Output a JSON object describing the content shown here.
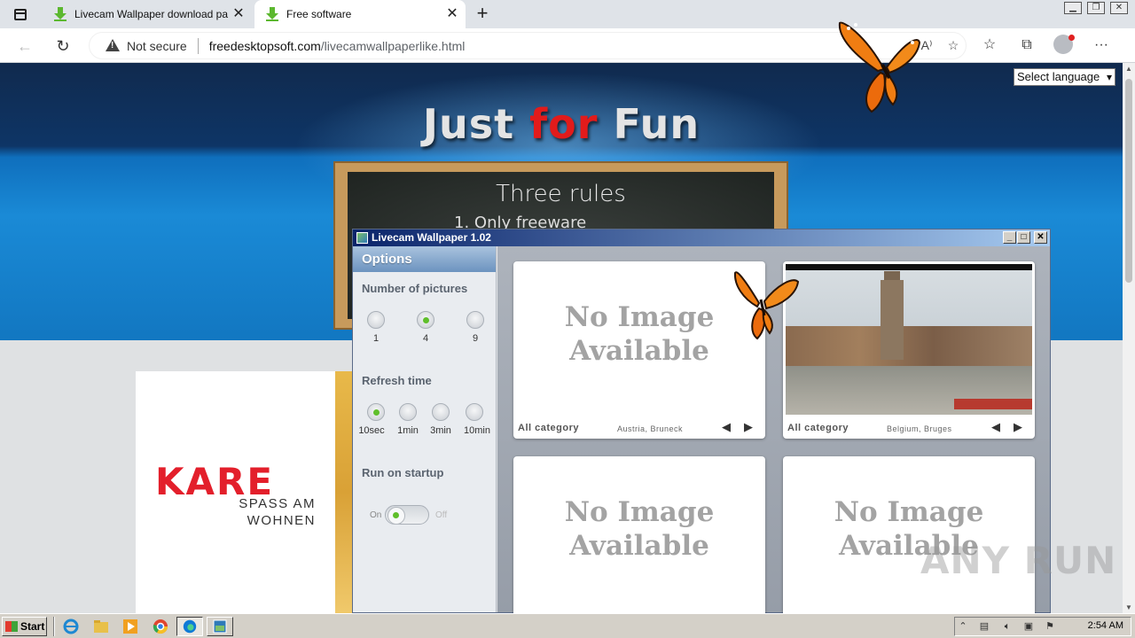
{
  "browser": {
    "tabs": [
      {
        "title": "Livecam Wallpaper download pa",
        "icon": "download-arrow-icon",
        "active": false
      },
      {
        "title": "Free software",
        "icon": "download-arrow-icon",
        "active": true
      }
    ],
    "security_label": "Not secure",
    "url_host": "freedesktopsoft.com",
    "url_path": "/livecamwallpaperlike.html"
  },
  "page": {
    "language_select": "Select language",
    "hero": {
      "title_part1": "Just ",
      "title_part2": "for",
      "title_part3": " Fun"
    },
    "board": {
      "title": "Three rules",
      "rule1": "1. Only freeware"
    },
    "ad": {
      "brand": "KARE",
      "tagline1": "SPASS AM",
      "tagline2": "WOHNEN"
    }
  },
  "app": {
    "title": "Livecam Wallpaper 1.02",
    "options": {
      "header": "Options",
      "pictures_label": "Number of pictures",
      "pictures": [
        {
          "label": "1",
          "selected": false
        },
        {
          "label": "4",
          "selected": true
        },
        {
          "label": "9",
          "selected": false
        }
      ],
      "refresh_label": "Refresh time",
      "refresh": [
        {
          "label": "10sec",
          "selected": true
        },
        {
          "label": "1min",
          "selected": false
        },
        {
          "label": "3min",
          "selected": false
        },
        {
          "label": "10min",
          "selected": false
        }
      ],
      "startup_label": "Run on startup",
      "startup_on": "On",
      "startup_off": "Off",
      "startup_value": "On"
    },
    "cams": [
      {
        "placeholder_line1": "No Image",
        "placeholder_line2": "Available",
        "category": "All category",
        "location": "Austria, Bruneck",
        "has_image": false
      },
      {
        "placeholder_line1": "",
        "placeholder_line2": "",
        "category": "All category",
        "location": "Belgium, Bruges",
        "has_image": true
      },
      {
        "placeholder_line1": "No Image",
        "placeholder_line2": "Available",
        "category": "",
        "location": "",
        "has_image": false
      },
      {
        "placeholder_line1": "No Image",
        "placeholder_line2": "Available",
        "category": "",
        "location": "",
        "has_image": false
      }
    ]
  },
  "taskbar": {
    "start_label": "Start",
    "clock": "2:54 AM"
  },
  "watermark": "ANY RUN"
}
